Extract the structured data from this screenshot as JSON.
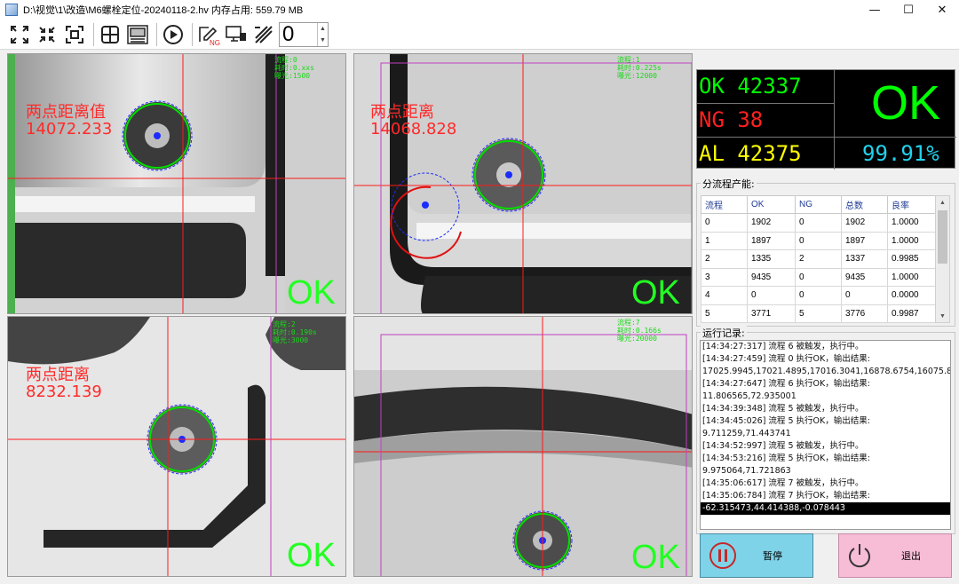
{
  "window": {
    "title": "D:\\视觉\\1\\改造\\M6螺栓定位-20240118-2.hv 内存占用: 559.79 MB",
    "min": "—",
    "max": "☐",
    "close": "✕"
  },
  "toolbar": {
    "spin_value": "0",
    "spin_up": "▲",
    "spin_down": "▼"
  },
  "cameras": [
    {
      "dist_label": "两点距离值",
      "dist_value": "14072.233",
      "result": "OK",
      "info": [
        "流程:0",
        "耗时:0.xxs",
        "曝光:1500"
      ]
    },
    {
      "dist_label": "两点距离",
      "dist_value": "14068.828",
      "result": "OK",
      "info": [
        "流程:1",
        "耗时:0.225s",
        "曝光:12000"
      ]
    },
    {
      "dist_label": "两点距离",
      "dist_value": "8232.139",
      "result": "OK",
      "info": [
        "流程:2",
        "耗时:0.190s",
        "曝光:3000"
      ]
    },
    {
      "dist_label": "",
      "dist_value": "",
      "result": "OK",
      "info": [
        "流程:7",
        "耗时:0.166s",
        "曝光:20000"
      ]
    }
  ],
  "stats": {
    "ok": "OK 42337",
    "ng": "NG 38",
    "al": "AL 42375",
    "result": "OK",
    "rate": "99.91%",
    "colors": {
      "ok": "#00ff00",
      "ng": "#ff2020",
      "al": "#ffff00",
      "rate": "#22d3ee"
    }
  },
  "process_section": {
    "label": "分流程产能:",
    "headers": [
      "流程",
      "OK",
      "NG",
      "总数",
      "良率"
    ],
    "rows": [
      [
        "0",
        "1902",
        "0",
        "1902",
        "1.0000"
      ],
      [
        "1",
        "1897",
        "0",
        "1897",
        "1.0000"
      ],
      [
        "2",
        "1335",
        "2",
        "1337",
        "0.9985"
      ],
      [
        "3",
        "9435",
        "0",
        "9435",
        "1.0000"
      ],
      [
        "4",
        "0",
        "0",
        "0",
        "0.0000"
      ],
      [
        "5",
        "3771",
        "5",
        "3776",
        "0.9987"
      ]
    ]
  },
  "log_section": {
    "label": "运行记录:",
    "lines": [
      "[14:34:27:317] 流程 6 被触发，执行中。",
      "[14:34:27:459] 流程 0 执行OK，输出结果:",
      "17025.9945,17021.4895,17016.3041,16878.6754,16075.8541,1",
      "[14:34:27:647] 流程 6 执行OK，输出结果:",
      "11.806565,72.935001",
      "[14:34:39:348] 流程 5 被触发，执行中。",
      "[14:34:45:026] 流程 5 执行OK，输出结果:",
      "9.711259,71.443741",
      "[14:34:52:997] 流程 5 被触发，执行中。",
      "[14:34:53:216] 流程 5 执行OK，输出结果:",
      "9.975064,71.721863",
      "[14:35:06:617] 流程 7 被触发，执行中。",
      "[14:35:06:784] 流程 7 执行OK，输出结果:",
      "-62.315473,44.414388,-0.078443"
    ]
  },
  "buttons": {
    "pause": "暂停",
    "exit": "退出"
  }
}
